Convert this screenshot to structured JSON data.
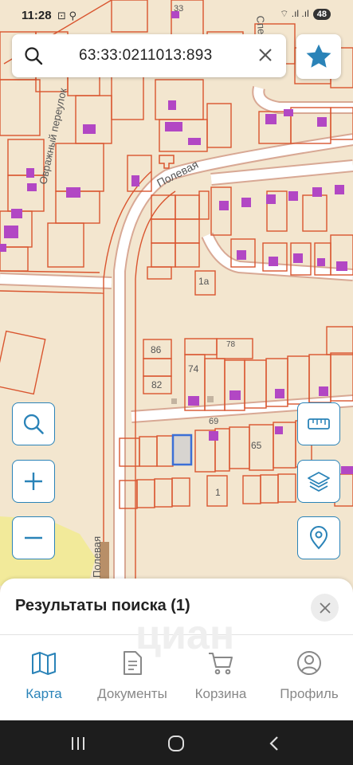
{
  "status_bar": {
    "time": "11:28",
    "left_icons": "⊡ ⚲",
    "right_icons": "⌔ .ıl .ıl",
    "battery": "48"
  },
  "search": {
    "value": "63:33:0211013:893",
    "icon": "search-icon",
    "clear_icon": "close-icon"
  },
  "favorite": {
    "icon": "star-icon",
    "color": "#2a83b8"
  },
  "map": {
    "labels": {
      "street_top_partial": "Спец",
      "street_top_left_partial": "33",
      "ovrazhny": "Овражный переулок",
      "polevaya_top": "Полевая",
      "polevaya_bottom": "Полевая",
      "n1a": "1а",
      "n86": "86",
      "n82": "82",
      "n74": "74",
      "n78": "78",
      "n69": "69",
      "n65": "65",
      "n1": "1"
    },
    "colors": {
      "base": "#f3e6cf",
      "parcel_stroke": "#d9552f",
      "building": "#b247c4",
      "road": "#ffffff",
      "road_edge": "#d8a894",
      "park": "#f2ea9a",
      "selected": "#3b6fd6"
    }
  },
  "map_controls": {
    "search": "search-icon",
    "zoom_in": "plus-icon",
    "zoom_out": "minus-icon",
    "ruler": "ruler-icon",
    "layers": "layers-icon",
    "location": "location-pin-icon"
  },
  "results_panel": {
    "title": "Результаты поиска (1)",
    "close_icon": "close-icon"
  },
  "tabs": [
    {
      "label": "Карта",
      "icon": "map-icon",
      "active": true
    },
    {
      "label": "Документы",
      "icon": "document-icon",
      "active": false
    },
    {
      "label": "Корзина",
      "icon": "cart-icon",
      "active": false
    },
    {
      "label": "Профиль",
      "icon": "profile-icon",
      "active": false
    }
  ],
  "watermark": "циан",
  "system_nav": {
    "recents": "recents-icon",
    "home": "home-icon",
    "back": "back-icon"
  }
}
